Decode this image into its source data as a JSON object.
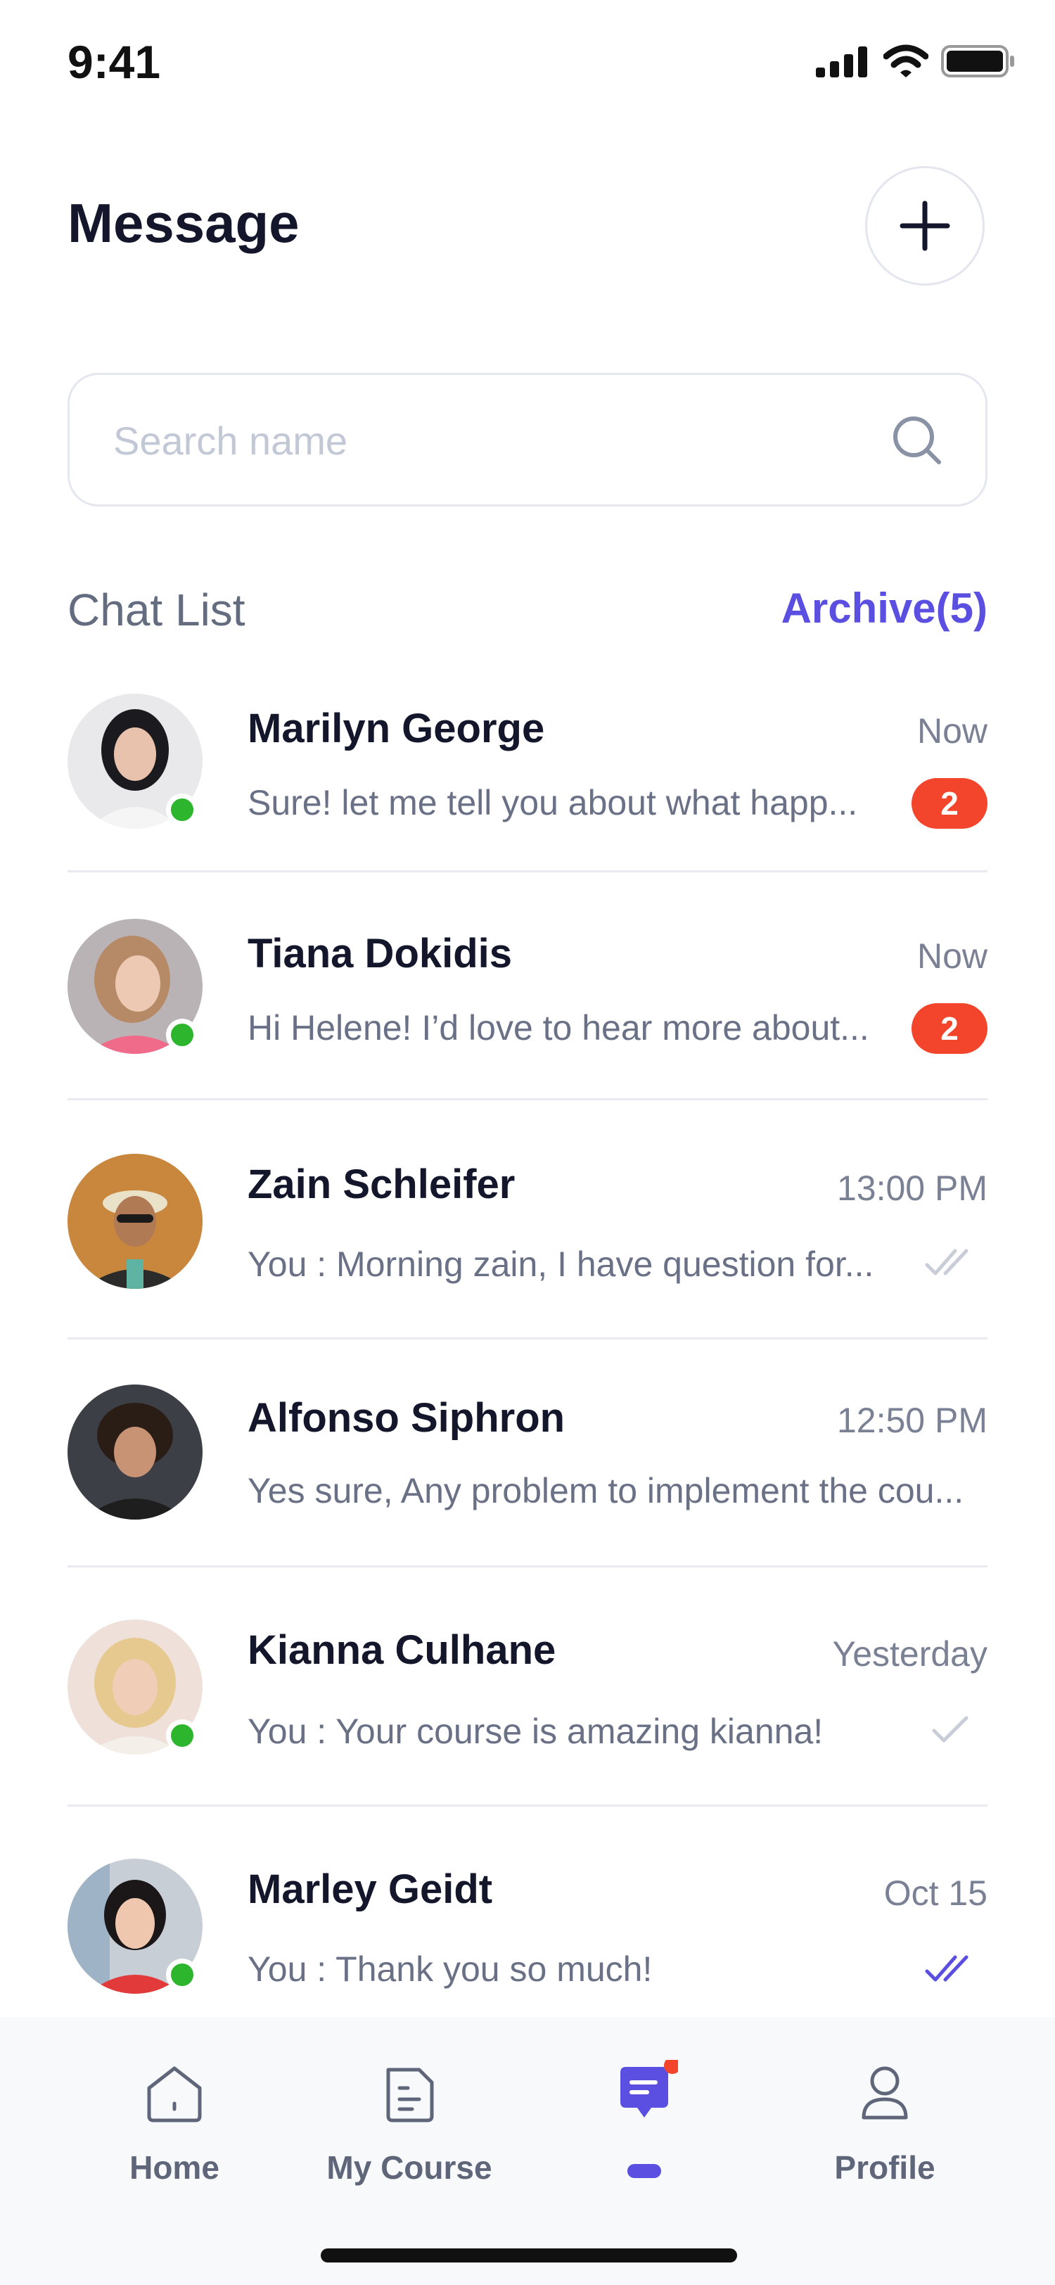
{
  "status_bar": {
    "time": "9:41"
  },
  "header": {
    "title": "Message"
  },
  "search": {
    "placeholder": "Search name"
  },
  "chat_list": {
    "title": "Chat List",
    "archive_label": "Archive(5)"
  },
  "chats": [
    {
      "name": "Marilyn George",
      "time": "Now",
      "preview": "Sure! let me tell you about what happ...",
      "unread": "2",
      "online": true,
      "status": "unread"
    },
    {
      "name": "Tiana Dokidis",
      "time": "Now",
      "preview": "Hi Helene! I’d love to hear more about...",
      "unread": "2",
      "online": true,
      "status": "unread"
    },
    {
      "name": "Zain Schleifer",
      "time": "13:00 PM",
      "preview": "You : Morning zain, I have question for...",
      "online": false,
      "status": "delivered"
    },
    {
      "name": "Alfonso Siphron",
      "time": "12:50 PM",
      "preview": "Yes sure, Any problem to implement the cou...",
      "online": false,
      "status": "none"
    },
    {
      "name": "Kianna Culhane",
      "time": "Yesterday",
      "preview": "You : Your course is amazing kianna!",
      "online": true,
      "status": "sent"
    },
    {
      "name": "Marley Geidt",
      "time": "Oct 15",
      "preview": "You : Thank you so much!",
      "online": true,
      "status": "read"
    }
  ],
  "bottom_nav": [
    {
      "label": "Home",
      "icon": "home-icon"
    },
    {
      "label": "My Course",
      "icon": "document-icon"
    },
    {
      "label": "",
      "icon": "chat-bubble-icon",
      "active": true
    },
    {
      "label": "Profile",
      "icon": "person-icon"
    }
  ],
  "colors": {
    "accent": "#5a4fe0",
    "badge": "#f2452b",
    "online": "#2db52d",
    "read_tick": "#5a4fe0",
    "unread_tick": "#c9cdd8"
  }
}
